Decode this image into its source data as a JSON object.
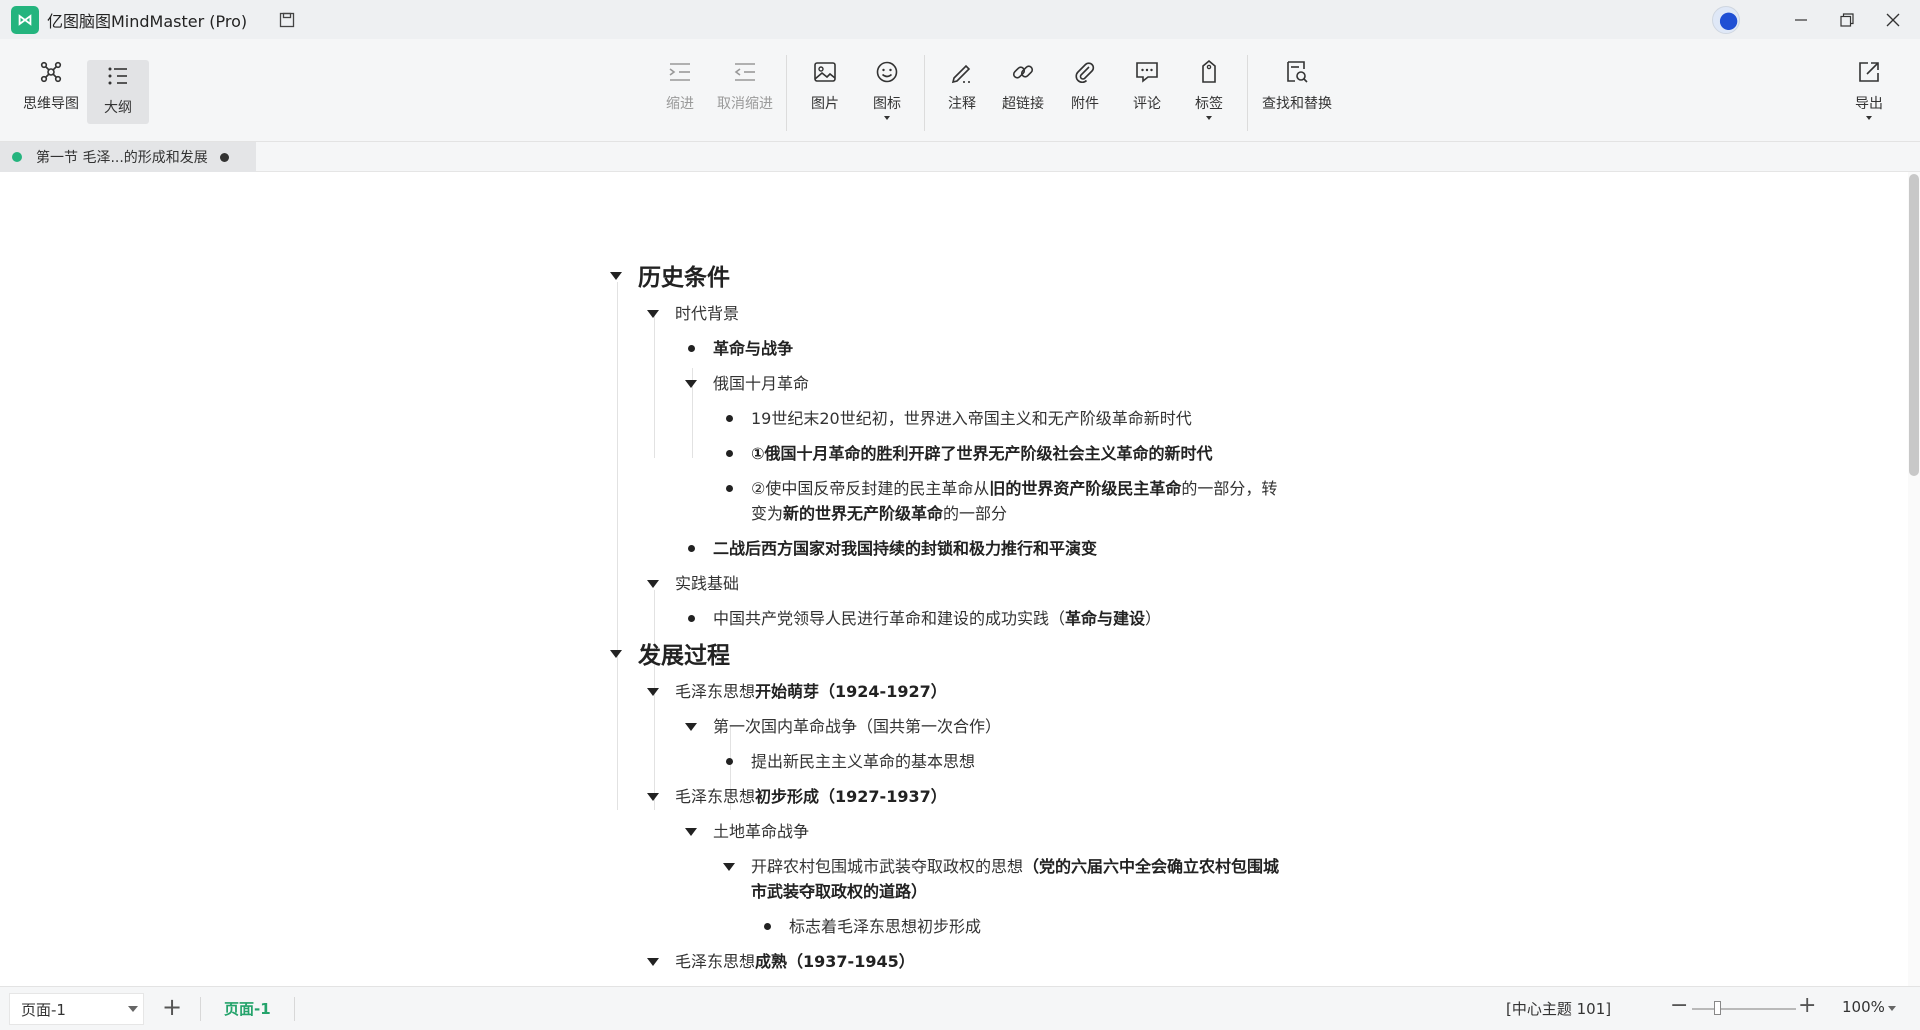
{
  "window": {
    "title": "亿图脑图MindMaster (Pro)",
    "logo_color": "#24b47e"
  },
  "toolbar": {
    "mindmap_label": "思维导图",
    "outline_label": "大纲",
    "indent_label": "缩进",
    "unindent_label": "取消缩进",
    "image_label": "图片",
    "icon_label": "图标",
    "note_label": "注释",
    "hyperlink_label": "超链接",
    "attachment_label": "附件",
    "comment_label": "评论",
    "tag_label": "标签",
    "find_replace_label": "查找和替换",
    "export_label": "导出"
  },
  "doc_tab": {
    "label": "第一节 毛泽...的形成和发展"
  },
  "outline": {
    "r1": "历史条件",
    "r2": "时代背景",
    "r3": "革命与战争",
    "r4": "俄国十月革命",
    "r5": "19世纪末20世纪初，世界进入帝国主义和无产阶级革命新时代",
    "r6": "①俄国十月革命的胜利开辟了世界无产阶级社会主义革命的新时代",
    "r7a": "②使中国反帝反封建的民主革命从",
    "r7b": "旧的世界资产阶级民主革命",
    "r7c": "的一部分，转",
    "r7d": "变为",
    "r7e": "新的世界无产阶级革命",
    "r7f": "的一部分",
    "r8": "二战后西方国家对我国持续的封锁和极力推行和平演变",
    "r9": "实践基础",
    "r10a": "中国共产党领导人民进行革命和建设的成功实践（",
    "r10b": "革命与建设",
    "r10c": "）",
    "r11": "发展过程",
    "r12a": "毛泽东思想",
    "r12b": "开始萌芽（1924-1927）",
    "r13": "第一次国内革命战争（国共第一次合作）",
    "r14": "提出新民主主义革命的基本思想",
    "r15a": "毛泽东思想",
    "r15b": "初步形成（1927-1937）",
    "r16": "土地革命战争",
    "r17a": "开辟农村包围城市武装夺取政权的思想",
    "r17b": "（党的六届六中全会确立农村包围城",
    "r17c": "市武装夺取政权的道路）",
    "r18": "标志着毛泽东思想初步形成",
    "r19a": "毛泽东思想",
    "r19b": "成熟（1937-1945）"
  },
  "bottom": {
    "page_select": "页面-1",
    "page_tab": "页面-1",
    "status": "[中心主题 101]",
    "zoom": "100%",
    "zoom_fraction": 0.25
  }
}
